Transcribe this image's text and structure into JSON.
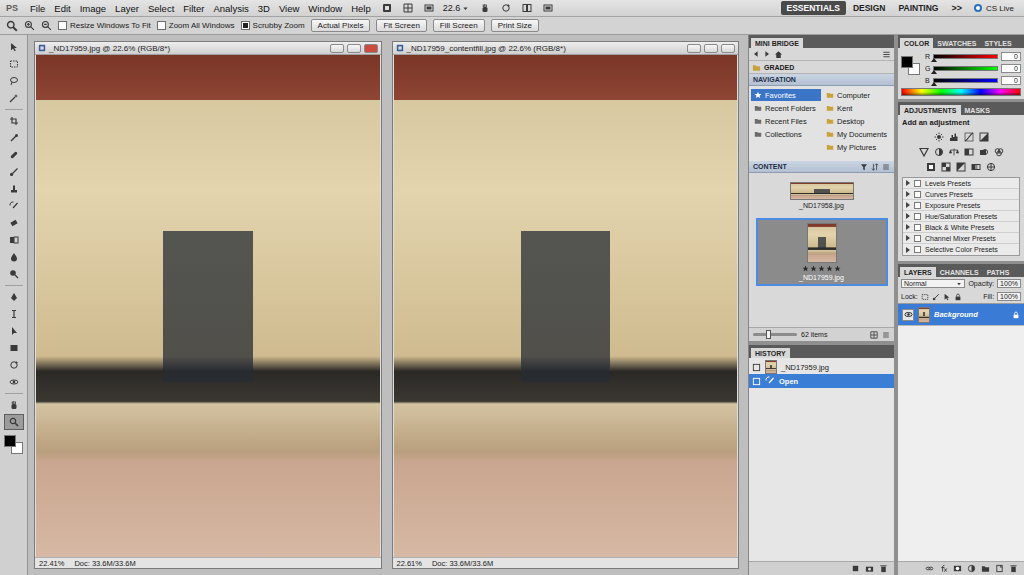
{
  "menu_bar": {
    "logo": "PS",
    "items": [
      "File",
      "Edit",
      "Image",
      "Layer",
      "Select",
      "Filter",
      "Analysis",
      "3D",
      "View",
      "Window",
      "Help"
    ],
    "zoom": "22.6",
    "workspaces": [
      {
        "label": "ESSENTIALS",
        "selected": true
      },
      {
        "label": "DESIGN",
        "selected": false
      },
      {
        "label": "PAINTING",
        "selected": false
      }
    ],
    "more": ">>",
    "cs_live": "CS Live"
  },
  "options_bar": {
    "checkboxes": [
      {
        "label": "Resize Windows To Fit",
        "checked": false
      },
      {
        "label": "Zoom All Windows",
        "checked": false
      },
      {
        "label": "Scrubby Zoom",
        "checked": true
      }
    ],
    "buttons": [
      "Actual Pixels",
      "Fit Screen",
      "Fill Screen",
      "Print Size"
    ]
  },
  "toolbox": {
    "tools": [
      {
        "selected": false
      },
      {
        "selected": false
      },
      {
        "selected": false
      },
      {
        "selected": false
      },
      {
        "selected": false
      },
      {
        "selected": false
      },
      {
        "selected": false
      },
      {
        "selected": false
      },
      {
        "selected": false
      },
      {
        "selected": false
      },
      {
        "selected": false
      },
      {
        "selected": false
      },
      {
        "selected": false
      },
      {
        "selected": false
      },
      {
        "selected": false
      },
      {
        "selected": false
      },
      {
        "selected": false
      },
      {
        "selected": false
      },
      {
        "selected": false
      },
      {
        "selected": false
      },
      {
        "selected": false
      },
      {
        "selected": true
      }
    ]
  },
  "documents": [
    {
      "title": "_ND17959.jpg @ 22.6% (RGB/8*)",
      "active": true,
      "zoom": "22.41%",
      "doc": "Doc: 33.6M/33.6M"
    },
    {
      "title": "_ND17959_contentfill.jpg @ 22.6% (RGB/8*)",
      "active": false,
      "zoom": "22.61%",
      "doc": "Doc: 33.6M/33.6M"
    }
  ],
  "mini_bridge": {
    "tab": "MINI BRIDGE",
    "path": "GRADED",
    "navigation": {
      "title": "NAVIGATION",
      "places": [
        {
          "label": "Favorites",
          "selected": true
        },
        {
          "label": "Recent Folders",
          "selected": false
        },
        {
          "label": "Recent Files",
          "selected": false
        },
        {
          "label": "Collections",
          "selected": false
        }
      ],
      "folders": [
        "Computer",
        "Kent",
        "Desktop",
        "My Documents",
        "My Pictures"
      ]
    },
    "content": {
      "title": "CONTENT",
      "items": [
        {
          "name": "_ND17958.jpg",
          "selected": false,
          "stars": 0
        },
        {
          "name": "_ND17959.jpg",
          "selected": true,
          "stars": 5
        }
      ],
      "count": "62 items",
      "thumb_size": 0.35
    }
  },
  "history": {
    "tab": "HISTORY",
    "items": [
      {
        "label": "_ND17959.jpg",
        "kind": "snapshot",
        "selected": false
      },
      {
        "label": "Open",
        "kind": "step",
        "selected": true
      }
    ]
  },
  "color": {
    "tabs": [
      {
        "label": "COLOR",
        "selected": true
      },
      {
        "label": "SWATCHES",
        "selected": false
      },
      {
        "label": "STYLES",
        "selected": false
      }
    ],
    "channels": [
      {
        "name": "R",
        "value": "0",
        "level": 0,
        "color": "#ff0000"
      },
      {
        "name": "G",
        "value": "0",
        "level": 0,
        "color": "#00ff00"
      },
      {
        "name": "B",
        "value": "0",
        "level": 0,
        "color": "#0000ff"
      }
    ]
  },
  "adjustments": {
    "tabs": [
      {
        "label": "ADJUSTMENTS",
        "selected": true
      },
      {
        "label": "MASKS",
        "selected": false
      }
    ],
    "hint": "Add an adjustment",
    "presets": [
      {
        "label": "Levels Presets",
        "expanded": false
      },
      {
        "label": "Curves Presets",
        "expanded": false
      },
      {
        "label": "Exposure Presets",
        "expanded": false
      },
      {
        "label": "Hue/Saturation Presets",
        "expanded": false
      },
      {
        "label": "Black & White Presets",
        "expanded": false
      },
      {
        "label": "Channel Mixer Presets",
        "expanded": false
      },
      {
        "label": "Selective Color Presets",
        "expanded": false
      }
    ]
  },
  "layers": {
    "tabs": [
      {
        "label": "LAYERS",
        "selected": true
      },
      {
        "label": "CHANNELS",
        "selected": false
      },
      {
        "label": "PATHS",
        "selected": false
      }
    ],
    "blend_mode": "Normal",
    "opacity_label": "Opacity:",
    "opacity": "100%",
    "lock_label": "Lock:",
    "fill_label": "Fill:",
    "fill": "100%",
    "items": [
      {
        "name": "Background",
        "selected": true,
        "visible": true,
        "locked": true
      }
    ]
  }
}
